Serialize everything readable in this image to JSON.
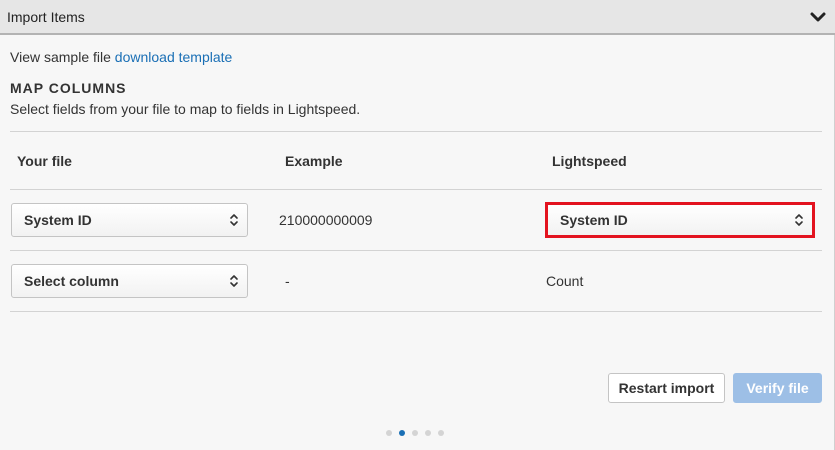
{
  "header": {
    "title": "Import Items"
  },
  "sample": {
    "prefix": "View sample file",
    "link_label": "download template"
  },
  "map_columns": {
    "title": "MAP COLUMNS",
    "description": "Select fields from your file to map to fields in Lightspeed."
  },
  "table": {
    "headers": [
      "Your file",
      "Example",
      "Lightspeed"
    ],
    "rows": [
      {
        "your_file": "System ID",
        "example": "210000000009",
        "lightspeed": "System ID"
      },
      {
        "your_file": "Select column",
        "example": "-",
        "lightspeed": "Count"
      }
    ]
  },
  "buttons": {
    "restart": "Restart import",
    "verify": "Verify file"
  },
  "pager": {
    "total": 5,
    "active_index": 1
  },
  "colors": {
    "link": "#1a6fb5",
    "highlight": "#e3131f",
    "verify_disabled": "#9dbfe6"
  }
}
